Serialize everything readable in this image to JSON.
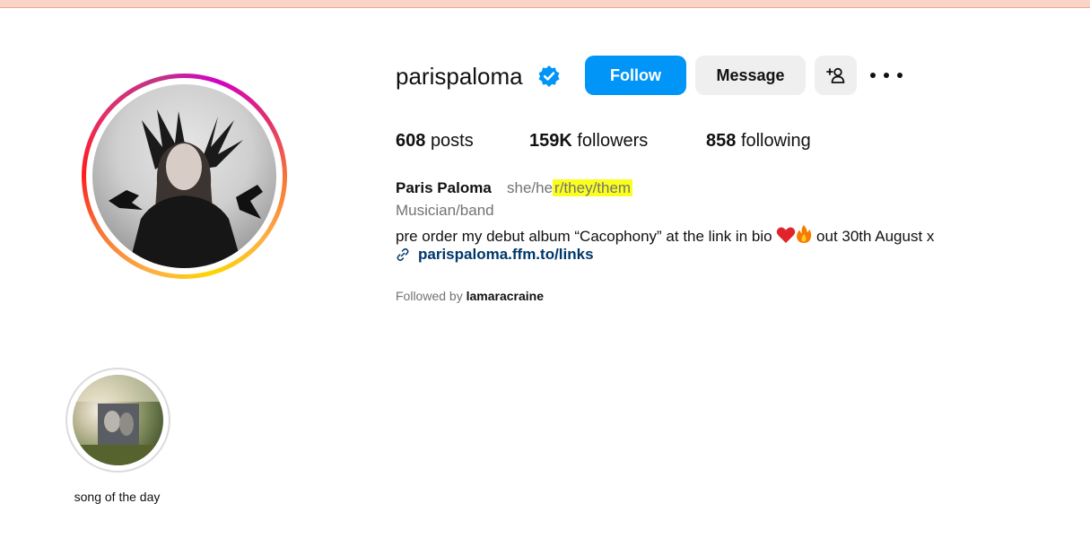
{
  "profile": {
    "username": "parispaloma",
    "buttons": {
      "follow": "Follow",
      "message": "Message"
    },
    "stats": {
      "posts_count": "608",
      "posts_label": "posts",
      "followers_count": "159K",
      "followers_label": "followers",
      "following_count": "858",
      "following_label": "following"
    },
    "full_name": "Paris Paloma",
    "pronouns_plain": "she/he",
    "pronouns_highlighted": "r/they/them",
    "category": "Musician/band",
    "bio_before_emoji": "pre order my debut album “Cacophony” at the link in bio",
    "bio_after_emoji": "out 30th August x",
    "link": "parispaloma.ffm.to/links",
    "followed_by_prefix": "Followed by",
    "followed_by_user": "lamaracraine"
  },
  "highlights": [
    {
      "label": "song of the day"
    }
  ],
  "icons": {
    "verified": "verified-badge-icon",
    "add_user": "add-user-icon",
    "more": "more-options-icon",
    "link": "link-icon",
    "emojis": [
      "red-heart-emoji",
      "fire-emoji"
    ]
  },
  "colors": {
    "primary_button": "#0095f6",
    "secondary_button": "#efefef",
    "highlighter": "#fbff1f",
    "link_text": "#00376b",
    "muted_text": "#737373"
  }
}
